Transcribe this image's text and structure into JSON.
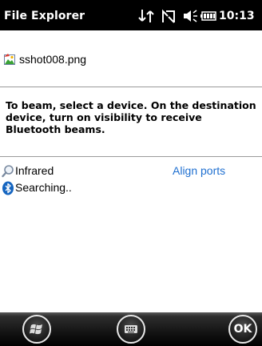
{
  "titlebar": {
    "app_title": "File Explorer",
    "clock": "10:13",
    "icons": [
      "connectivity-icon",
      "signal-off-icon",
      "volume-icon",
      "battery-icon"
    ]
  },
  "file": {
    "name": "sshot008.png",
    "icon": "image-file-icon"
  },
  "instructions": "To beam, select a device. On the destination device, turn on visibility to receive Bluetooth beams.",
  "devices": [
    {
      "label": "Infrared",
      "icon": "search-icon",
      "action": "Align ports"
    },
    {
      "label": "Searching..",
      "icon": "bluetooth-icon"
    }
  ],
  "taskbar": {
    "start_icon": "windows-start-icon",
    "keyboard_icon": "keyboard-icon",
    "ok_label": "OK"
  },
  "colors": {
    "titlebar_bg": "#000000",
    "link": "#1e6fd0",
    "bluetooth": "#1565c0"
  }
}
